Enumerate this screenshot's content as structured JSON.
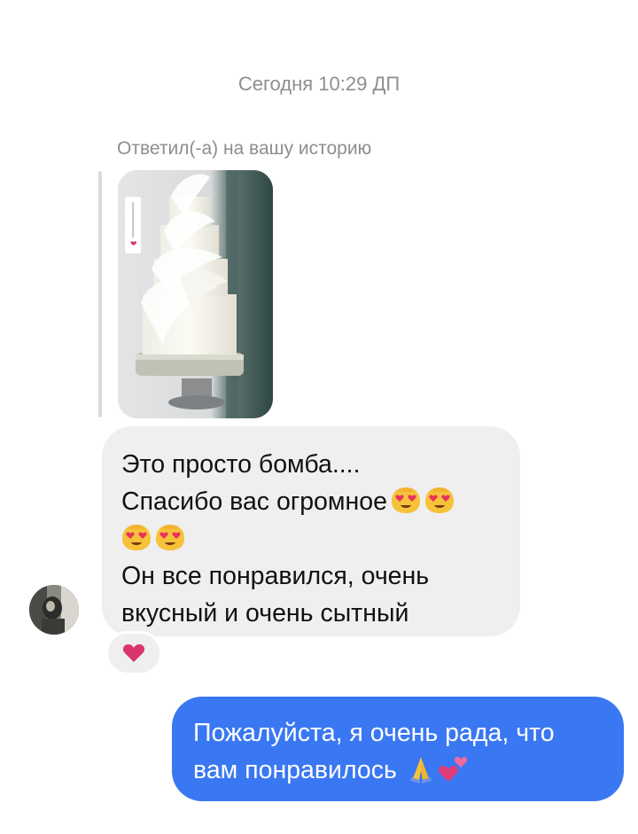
{
  "chat": {
    "timestamp": "Сегодня 10:29 ДП",
    "story_reply_label": "Ответил(-а) на вашу историю",
    "incoming_message": {
      "line1": "Это просто бомба....",
      "line2": "Спасибо вас огромное",
      "line2_emojis": [
        "heart-eyes-emoji",
        "heart-eyes-emoji"
      ],
      "line3_emojis": [
        "heart-eyes-emoji",
        "heart-eyes-emoji"
      ],
      "line4": "Он все понравился, очень",
      "line5": "вкусный и очень сытный",
      "reaction": "heart-icon"
    },
    "outgoing_message": {
      "line1": "Пожалуйста, я очень рада, что",
      "line2": "вам понравилось",
      "line2_emojis": [
        "folded-hands-emoji",
        "two-hearts-emoji"
      ]
    }
  },
  "colors": {
    "incoming_bubble": "#efefef",
    "outgoing_bubble": "#3a77f2",
    "meta_text": "#8e8e8e",
    "heart": "#d9356b"
  }
}
